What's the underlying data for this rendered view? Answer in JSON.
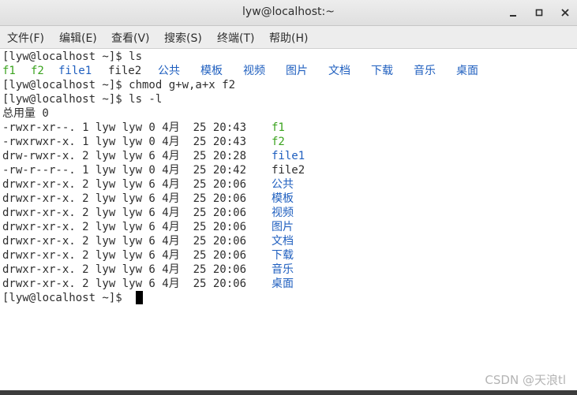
{
  "window": {
    "title": "lyw@localhost:~"
  },
  "menu": [
    "文件(F)",
    "编辑(E)",
    "查看(V)",
    "搜索(S)",
    "终端(T)",
    "帮助(H)"
  ],
  "terminal": {
    "lines": [
      {
        "segs": [
          {
            "text": "[lyw@localhost ~]$ ls"
          }
        ]
      },
      {
        "segs": [
          {
            "text": "f1",
            "color": "green"
          },
          {
            "text": "f2",
            "color": "green"
          },
          {
            "text": "file1",
            "color": "blue"
          },
          {
            "text": "file2"
          },
          {
            "text": "公共",
            "color": "blue"
          },
          {
            "text": "模板",
            "color": "blue"
          },
          {
            "text": "视频",
            "color": "blue"
          },
          {
            "text": "图片",
            "color": "blue"
          },
          {
            "text": "文档",
            "color": "blue"
          },
          {
            "text": "下载",
            "color": "blue"
          },
          {
            "text": "音乐",
            "color": "blue"
          },
          {
            "text": "桌面",
            "color": "blue"
          }
        ]
      },
      {
        "segs": [
          {
            "text": "[lyw@localhost ~]$ chmod g+w,a+x f2"
          }
        ]
      },
      {
        "segs": [
          {
            "text": "[lyw@localhost ~]$ ls -l"
          }
        ]
      },
      {
        "segs": [
          {
            "text": "总用量 0"
          }
        ]
      },
      {
        "segs": [
          {
            "text": "-rwxr-xr--. 1 lyw lyw 0 4月  25 20:43 "
          },
          {
            "text": "f1",
            "color": "green"
          }
        ]
      },
      {
        "segs": [
          {
            "text": "-rwxrwxr-x. 1 lyw lyw 0 4月  25 20:43 "
          },
          {
            "text": "f2",
            "color": "green"
          }
        ]
      },
      {
        "segs": [
          {
            "text": "drw-rwxr-x. 2 lyw lyw 6 4月  25 20:28 "
          },
          {
            "text": "file1",
            "color": "blue"
          }
        ]
      },
      {
        "segs": [
          {
            "text": "-rw-r--r--. 1 lyw lyw 0 4月  25 20:42 "
          },
          {
            "text": "file2"
          }
        ]
      },
      {
        "segs": [
          {
            "text": "drwxr-xr-x. 2 lyw lyw 6 4月  25 20:06 "
          },
          {
            "text": "公共",
            "color": "blue"
          }
        ]
      },
      {
        "segs": [
          {
            "text": "drwxr-xr-x. 2 lyw lyw 6 4月  25 20:06 "
          },
          {
            "text": "模板",
            "color": "blue"
          }
        ]
      },
      {
        "segs": [
          {
            "text": "drwxr-xr-x. 2 lyw lyw 6 4月  25 20:06 "
          },
          {
            "text": "视频",
            "color": "blue"
          }
        ]
      },
      {
        "segs": [
          {
            "text": "drwxr-xr-x. 2 lyw lyw 6 4月  25 20:06 "
          },
          {
            "text": "图片",
            "color": "blue"
          }
        ]
      },
      {
        "segs": [
          {
            "text": "drwxr-xr-x. 2 lyw lyw 6 4月  25 20:06 "
          },
          {
            "text": "文档",
            "color": "blue"
          }
        ]
      },
      {
        "segs": [
          {
            "text": "drwxr-xr-x. 2 lyw lyw 6 4月  25 20:06 "
          },
          {
            "text": "下载",
            "color": "blue"
          }
        ]
      },
      {
        "segs": [
          {
            "text": "drwxr-xr-x. 2 lyw lyw 6 4月  25 20:06 "
          },
          {
            "text": "音乐",
            "color": "blue"
          }
        ]
      },
      {
        "segs": [
          {
            "text": "drwxr-xr-x. 2 lyw lyw 6 4月  25 20:06 "
          },
          {
            "text": "桌面",
            "color": "blue"
          }
        ]
      },
      {
        "segs": [
          {
            "text": "[lyw@localhost ~]$ "
          }
        ]
      }
    ]
  },
  "watermark": "CSDN @天浪tl",
  "colors": {
    "green": "#3aa31e",
    "blue": "#1f5fbf",
    "text": "#2e2e2e"
  }
}
